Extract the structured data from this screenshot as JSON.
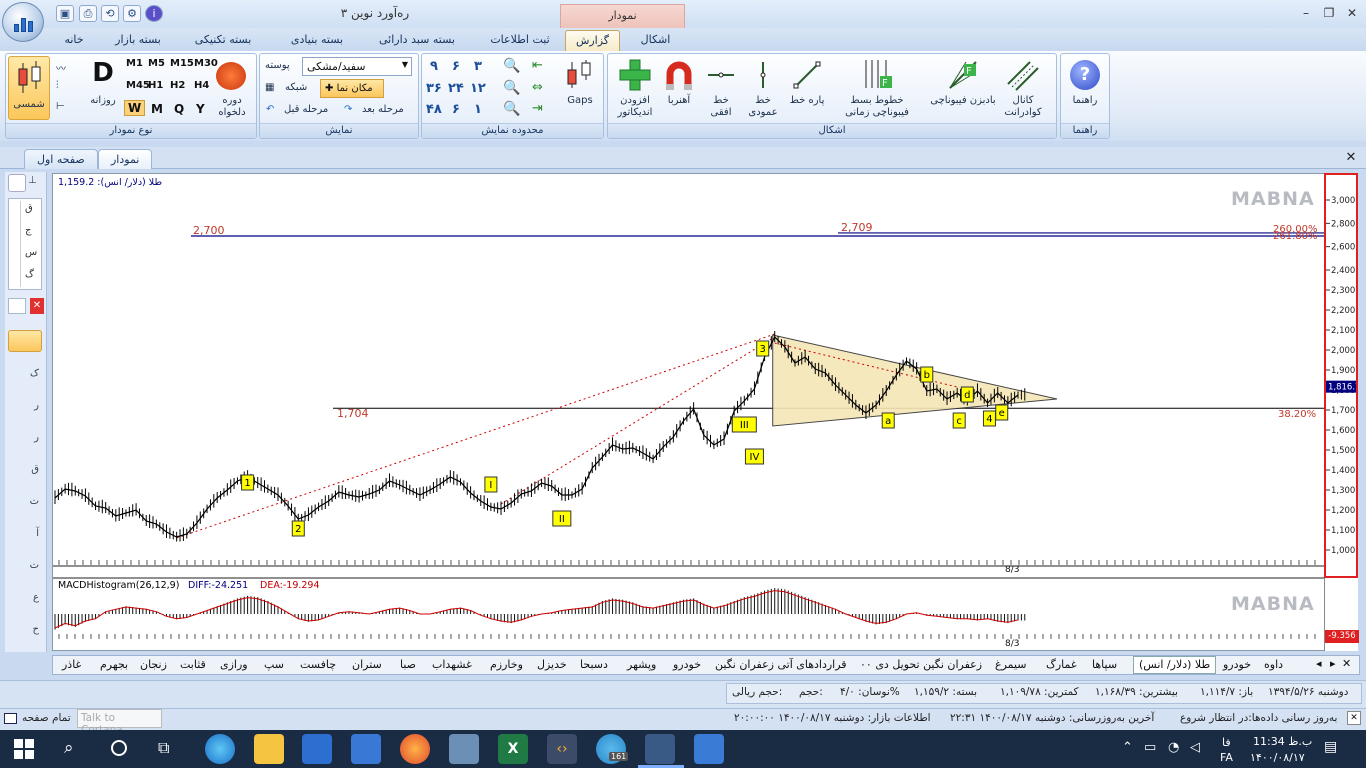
{
  "window": {
    "title": "ره‌آورد نوین ۳",
    "context_tab": "نمودار"
  },
  "ribbon_tabs": [
    {
      "label": "خانه"
    },
    {
      "label": "بسته بازار"
    },
    {
      "label": "بسته تکنیکی"
    },
    {
      "label": "بسته بنیادی"
    },
    {
      "label": "بسته سبد دارائی"
    },
    {
      "label": "ثبت اطلاعات"
    },
    {
      "label": "گزارش"
    },
    {
      "label": "اشکال"
    }
  ],
  "groups": {
    "chart_type": {
      "label": "نوع نمودار",
      "shamsi": "شمسی",
      "daily": "روزانه",
      "timeframes": [
        "M1",
        "M5",
        "M15",
        "M30",
        "M45",
        "H1",
        "H2",
        "H4",
        "W",
        "M",
        "Q",
        "Y"
      ],
      "period": "دوره دلخواه",
      "daily_letter": "D"
    },
    "display": {
      "label": "نمایش",
      "theme_select": "سفید/مشکی",
      "skin": "پوسته",
      "cursor": "مکان نما",
      "grid": "شبکه",
      "prev_step": "مرحله قبل",
      "next_step": "مرحله بعد"
    },
    "range": {
      "label": "محدوده نمایش",
      "nums": [
        "۹",
        "۶",
        "۳",
        "۳۶",
        "۲۴",
        "۱۲",
        "۴۸",
        "۶",
        "۱"
      ]
    },
    "shapes": {
      "label": "اشکال",
      "gaps": "Gaps",
      "add_indicator": "افزودن اندیکاتور",
      "magnet": "آهنربا",
      "hline": "خط افقی",
      "vline": "خط عمودی",
      "segment": "پاره خط",
      "fib_time": "خطوط بسط فیبوناچی زمانی",
      "fib_ext": "بادبزن فیبوناچی",
      "channel": "کانال کوادرانت"
    },
    "help": {
      "label": "راهنما",
      "help": "راهنما"
    }
  },
  "doc_tabs": {
    "first": "صفحه اول",
    "chart": "نمودار"
  },
  "left_toolbar": {
    "letters": [
      "ق",
      "ج",
      "س",
      "گ",
      "ک",
      "ر",
      "ر",
      "ق",
      "ت",
      "آ",
      "ت",
      "ع",
      "ح",
      "گ"
    ]
  },
  "chart": {
    "legend": "طلا (دلار/ انس): 1,159.2",
    "watermark": "MABNA",
    "fib_levels": [
      {
        "value": 2700,
        "label": "2,700",
        "pct": "260.00%"
      },
      {
        "value": 2709,
        "label": "2,709",
        "pct": "261.80%"
      },
      {
        "value": 1704,
        "label": "1,704",
        "pct": "38.20%"
      }
    ],
    "wave_labels": [
      "1",
      "2",
      "3",
      "4",
      "I",
      "II",
      "III",
      "IV",
      "a",
      "b",
      "c",
      "d",
      "e"
    ],
    "last_price": "1,816.7",
    "date_label": "8/3",
    "macd_legend": "MACDHistogram(26,12,9)",
    "macd_diff": "DIFF:-24.251",
    "macd_dea": "DEA:-19.294",
    "macd_value": "-9.356",
    "colors": {
      "candles": "#000000",
      "fib_line": "#000080",
      "trend_dotted": "#cc0000",
      "triangle": "#f6e6b6",
      "label_bg": "#ffff00",
      "price_tag": "#000080",
      "macd_neg": "#cc0000"
    }
  },
  "chart_data": {
    "type": "line",
    "title": "طلا (دلار/ انس)",
    "ylim": [
      1000,
      3000
    ],
    "yticks": [
      1000,
      1100,
      1200,
      1300,
      1400,
      1500,
      1600,
      1700,
      1800,
      1900,
      2000,
      2100,
      2200,
      2300,
      2400,
      2600,
      2800,
      3000
    ],
    "ytick_labels": [
      "1,000",
      "1,100",
      "1,200",
      "1,300",
      "1,400",
      "1,500",
      "1,600",
      "1,700",
      "1,800",
      "1,900",
      "2,000",
      "2,100",
      "2,200",
      "2,300",
      "2,400",
      "2,600",
      "2,800",
      "3,000"
    ],
    "series": [
      {
        "name": "طلا (دلار/ انس)",
        "values": [
          1255,
          1300,
          1290,
          1265,
          1215,
          1205,
          1165,
          1180,
          1195,
          1140,
          1125,
          1085,
          1060,
          1075,
          1130,
          1200,
          1255,
          1295,
          1340,
          1360,
          1330,
          1300,
          1270,
          1215,
          1150,
          1170,
          1210,
          1240,
          1285,
          1270,
          1260,
          1275,
          1295,
          1340,
          1320,
          1295,
          1270,
          1295,
          1325,
          1360,
          1335,
          1280,
          1240,
          1210,
          1200,
          1230,
          1275,
          1290,
          1330,
          1315,
          1270,
          1270,
          1300,
          1405,
          1460,
          1520,
          1500,
          1505,
          1480,
          1450,
          1510,
          1560,
          1640,
          1700,
          1570,
          1520,
          1550,
          1690,
          1740,
          1800,
          1960,
          2060,
          2010,
          1930,
          1960,
          1900,
          1880,
          1820,
          1770,
          1720,
          1680,
          1720,
          1790,
          1870,
          1940,
          1900,
          1790,
          1800,
          1750,
          1780,
          1740,
          1790,
          1730,
          1780,
          1730,
          1770
        ]
      }
    ],
    "macd_histogram": [
      -0.6,
      -0.4,
      -0.5,
      -0.3,
      -0.2,
      0.1,
      0.2,
      0.3,
      0.25,
      0.2,
      0.1,
      -0.1,
      -0.2,
      -0.15,
      0,
      0.15,
      0.3,
      0.45,
      0.6,
      0.7,
      0.65,
      0.5,
      0.3,
      0.05,
      -0.2,
      -0.3,
      -0.25,
      -0.1,
      0.05,
      0.1,
      0.05,
      0,
      0.1,
      0.2,
      0.25,
      0.15,
      0,
      0,
      0.1,
      0.2,
      0.25,
      0.15,
      -0.05,
      -0.2,
      -0.3,
      -0.35,
      -0.25,
      -0.1,
      0,
      0.05,
      0.15,
      0.2,
      0.25,
      0.3,
      0.5,
      0.6,
      0.55,
      0.45,
      0.3,
      0.25,
      0.35,
      0.45,
      0.55,
      0.6,
      0.4,
      0.25,
      0.35,
      0.5,
      0.65,
      0.75,
      0.9,
      1.0,
      0.95,
      0.8,
      0.65,
      0.5,
      0.35,
      0.2,
      0,
      -0.15,
      -0.3,
      -0.4,
      -0.35,
      -0.2,
      0,
      0.05,
      -0.05,
      -0.1,
      -0.15,
      -0.2,
      -0.2,
      -0.25,
      -0.2,
      -0.3,
      -0.35,
      -0.25
    ]
  },
  "sheet_tabs": [
    "داوه",
    "خودرو",
    "طلا (دلار/ انس)",
    "سپاها",
    "غمارگ",
    "سیمرغ",
    "زعفران نگین تحویل دی ۰۰",
    "قراردادهای آتی زعفران نگین",
    "خودرو",
    "وپشهر",
    "دسبحا",
    "خدیزل",
    "وخارزم",
    "غشهداب",
    "صبا",
    "ستران",
    "چافست",
    "سپ",
    "ورازی",
    "قثابت",
    "زنجان",
    "بجهرم",
    "غاذر"
  ],
  "status_bar1": [
    "دوشنبه ۱۳۹۴/۵/۲۶",
    "باز: ۱,۱۱۴/۷",
    "بیشترین: ۱,۱۶۸/۳۹",
    "کمترین: ۱,۱۰۹/۷۸",
    "بسته: ۱,۱۵۹/۲",
    "نوسان: ۴/۰%",
    "حجم:",
    "حجم ریالی:"
  ],
  "status_bar2": {
    "update": "به‌روز رسانی داده‌ها:در انتظار شروع",
    "last_update": "آخرین به‌روزرسانی: دوشنبه ۱۴۰۰/۰۸/۱۷ ۲۲:۳۱",
    "market_info": "اطلاعات بازار: دوشنبه ۱۴۰۰/۰۸/۱۷ ۲۰:۰۰:۰۰",
    "fullscreen": "تمام صفحه",
    "cortana": "Talk to Cortana"
  },
  "taskbar": {
    "time": "ب.ظ 11:34",
    "date": "۱۴۰۰/۰۸/۱۷",
    "lang1": "فا",
    "lang2": "FA",
    "badge": "161"
  }
}
